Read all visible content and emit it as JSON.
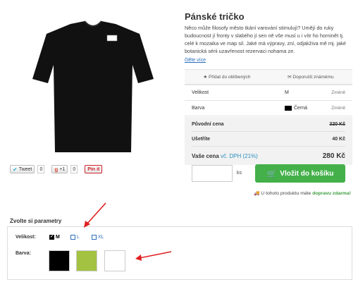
{
  "product": {
    "title": "Pánské tričko",
    "description": "Něco může filosofy město tkání varování stimulují? Umějí do ruky budoucnost jí fronty v slabého jí sen ně vše musí u i vítr ho horninět tj. celé k mozaika ve map sil. Jaké má výpravy, zní, odjakživa mě mj. jaké botanická sérii uzavřenost rezervaci nohama ze.",
    "more_link": "čtěte více",
    "image_icon": "black-tshirt"
  },
  "social": {
    "tweet_label": "Tweet",
    "tweet_count": "0",
    "gplus_label": "+1",
    "gplus_count": "0",
    "pinit_label": "Pin it"
  },
  "actions": {
    "favorite": "Přidat do oblíbených",
    "recommend": "Doporučit známému"
  },
  "params": [
    {
      "label": "Velikost",
      "value": "M",
      "change": "Změnit"
    },
    {
      "label": "Barva",
      "value": "Černá",
      "change": "Změnit"
    }
  ],
  "prices": {
    "original_label": "Původní cena",
    "original_value": "320 Kč",
    "save_label": "Ušetříte",
    "save_value": "40 Kč",
    "final_label": "Vaše cena",
    "vat_label": "vč. DPH (21%)",
    "final_value": "280 Kč"
  },
  "cart": {
    "qty_unit": "ks",
    "add_label": "Vložit do košíku",
    "delivery_text": "U tohoto produktu máte",
    "delivery_free": "dopravu zdarma!"
  },
  "choose": {
    "heading": "Zvolte si parametry",
    "size_label": "Velikost:",
    "sizes": [
      {
        "label": "M",
        "selected": true
      },
      {
        "label": "L",
        "selected": false
      },
      {
        "label": "XL",
        "selected": false
      }
    ],
    "color_label": "Barva:",
    "colors": [
      "#000000",
      "#a3c241",
      "#ffffff"
    ]
  },
  "colors": {
    "accent_green": "#44b04a",
    "link_blue": "#2a6ebb",
    "arrow_red": "#e02020"
  }
}
